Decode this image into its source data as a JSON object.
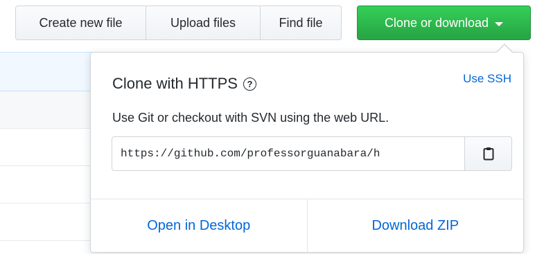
{
  "toolbar": {
    "create_label": "Create new file",
    "upload_label": "Upload files",
    "find_label": "Find file",
    "clone_label": "Clone or download"
  },
  "clone_panel": {
    "title": "Clone with HTTPS",
    "help_icon": "question-circle-icon",
    "use_ssh_label": "Use SSH",
    "description": "Use Git or checkout with SVN using the web URL.",
    "url_value": "https://github.com/professorguanabara/h",
    "copy_icon": "clipboard-icon",
    "open_desktop_label": "Open in Desktop",
    "download_zip_label": "Download ZIP"
  },
  "colors": {
    "primary_green": "#28a745",
    "link_blue": "#0366d6",
    "selected_row": "#f1f8ff"
  }
}
